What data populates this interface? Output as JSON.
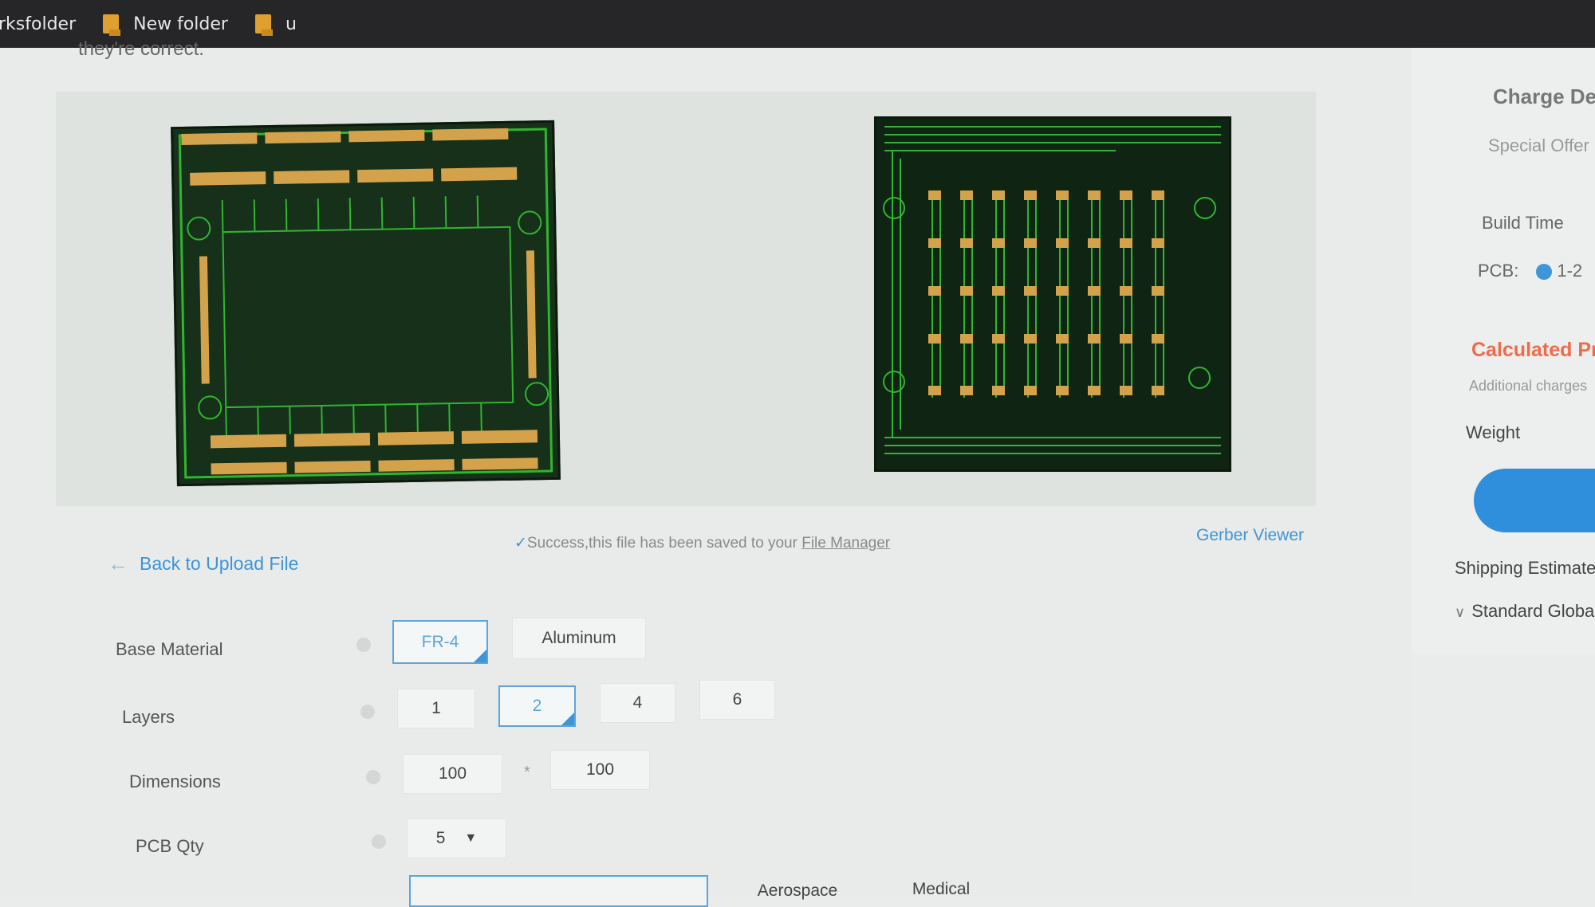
{
  "bookmarks": [
    {
      "label": "rksfolder",
      "folder_color": "#e0a030"
    },
    {
      "label": "New folder",
      "folder_color": "#e0a030"
    },
    {
      "label": "u",
      "folder_color": "#e0a030"
    }
  ],
  "page": {
    "clipped_text": "they're correct.",
    "back_link": "Back to Upload File",
    "success_text": "Success,this file has been saved to your",
    "file_manager": "File Manager",
    "gerber_viewer": "Gerber Viewer"
  },
  "form": {
    "base_material": {
      "label": "Base Material",
      "options": [
        "FR-4",
        "Aluminum"
      ],
      "selected": "FR-4"
    },
    "layers": {
      "label": "Layers",
      "options": [
        "1",
        "2",
        "4",
        "6"
      ],
      "selected": "2"
    },
    "dimensions": {
      "label": "Dimensions",
      "width": "100",
      "height": "100",
      "separator": "*"
    },
    "pcb_qty": {
      "label": "PCB Qty",
      "value": "5"
    },
    "product_types": [
      "Aerospace",
      "Medical"
    ]
  },
  "sidebar": {
    "charge_details": "Charge De",
    "special_offer": "Special Offer",
    "build_time": "Build Time",
    "pcb_label": "PCB:",
    "pcb_option": "1-2",
    "calculated_price": "Calculated Pr",
    "additional_charges": "Additional charges",
    "weight": "Weight",
    "shipping_estimate": "Shipping Estimate",
    "standard_global": "Standard Globa"
  },
  "colors": {
    "accent": "#3e95d8",
    "price_red": "#ef6b4a",
    "pcb_green": "#2fb52f",
    "pad_gold": "#d4a24a"
  }
}
